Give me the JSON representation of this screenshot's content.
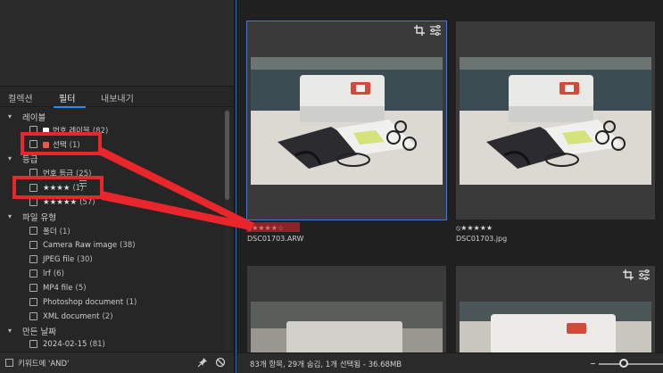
{
  "tabs": {
    "collections": "컬렉션",
    "filter": "필터",
    "export": "내보내기"
  },
  "sections": {
    "label": {
      "title": "레이블"
    },
    "rating": {
      "title": "등급"
    },
    "file_type": {
      "title": "파일 유형"
    },
    "created_date": {
      "title": "만든 날짜"
    }
  },
  "label_items": [
    {
      "text": "번호 레이블",
      "count": "(82)"
    },
    {
      "text": "선택",
      "count": "(1)",
      "swatch": "#e25b4f"
    }
  ],
  "rating_items": [
    {
      "text": "번호 등급",
      "count": "(25)"
    },
    {
      "stars": "★★★★",
      "count": "(1)"
    },
    {
      "stars": "★★★★★",
      "count": "(57)"
    }
  ],
  "file_type_items": [
    {
      "text": "폴더",
      "count": "(1)"
    },
    {
      "text": "Camera Raw image",
      "count": "(38)"
    },
    {
      "text": "JPEG file",
      "count": "(30)"
    },
    {
      "text": "lrf",
      "count": "(6)"
    },
    {
      "text": "MP4 file",
      "count": "(5)"
    },
    {
      "text": "Photoshop document",
      "count": "(1)"
    },
    {
      "text": "XML document",
      "count": "(2)"
    }
  ],
  "date_items": [
    {
      "text": "2024-02-15",
      "count": "(81)"
    }
  ],
  "bottom": {
    "keyword_label": "키워드에 'AND'"
  },
  "thumbnails": [
    {
      "filename": "DSC01703.ARW",
      "rating": "⦸★★★★☆",
      "selected": true
    },
    {
      "filename": "DSC01703.jpg",
      "rating": "⦸★★★★★",
      "selected": false
    }
  ],
  "status": {
    "text": "83개 항목, 29개 숨김, 1개 선택됨 - 36.68MB"
  },
  "colors": {
    "accent": "#1f8fff",
    "annotation": "#e8262c",
    "label_red": "#e25b4f"
  }
}
